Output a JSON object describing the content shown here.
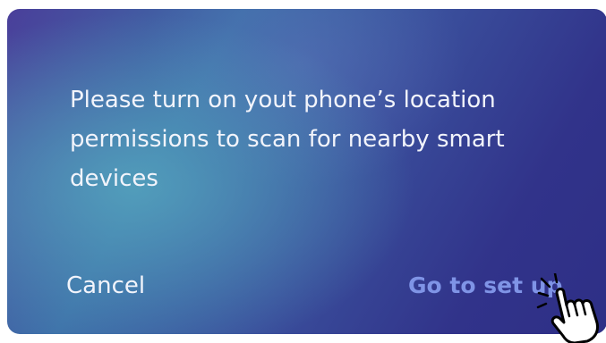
{
  "dialog": {
    "message": "Please turn on yout phone’s location permissions to scan for nearby smart devices",
    "cancel_label": "Cancel",
    "confirm_label": "Go to set up"
  },
  "colors": {
    "gradient_start": "#4a3f9a",
    "gradient_glow": "#55a5be",
    "gradient_end": "#2e2f86",
    "text": "#f2f4fb",
    "confirm_accent": "#7f94e6"
  },
  "icons": {
    "pointer": "hand-pointer-icon"
  }
}
